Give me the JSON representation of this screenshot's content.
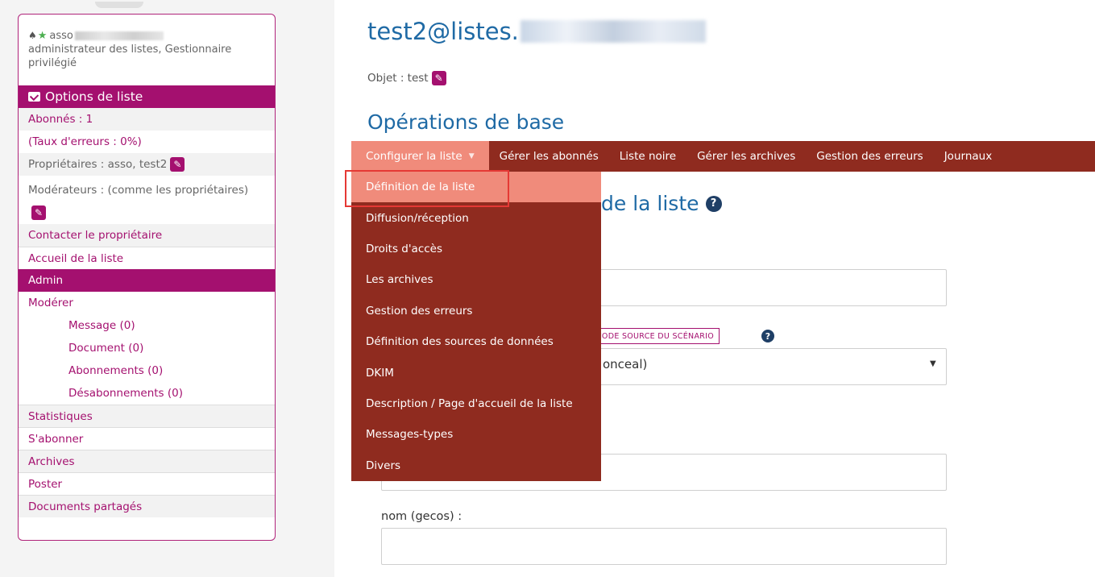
{
  "colors": {
    "accent": "#a4106f",
    "title_blue": "#1f6aa5",
    "menubar_bg": "#8f2b1f",
    "menu_highlight": "#f08b7b",
    "annotation_red": "#e53935"
  },
  "user": {
    "name_prefix": "asso",
    "roles": "administrateur des listes, Gestionnaire privilégié"
  },
  "sidebar": {
    "options_header": "Options de liste",
    "subscribers": "Abonnés : 1",
    "error_rate": "(Taux d'erreurs : 0%)",
    "owners": "Propriétaires : asso, test2",
    "moderators": "Modérateurs : (comme les propriétaires)",
    "contact_owner": "Contacter le propriétaire",
    "home": "Accueil de la liste",
    "admin": "Admin",
    "moderate": "Modérer",
    "moderate_items": [
      "Message (0)",
      "Document (0)",
      "Abonnements (0)",
      "Désabonnements (0)"
    ],
    "stats": "Statistiques",
    "subscribe": "S'abonner",
    "archives": "Archives",
    "post": "Poster",
    "shared_docs": "Documents partagés"
  },
  "main": {
    "list_title_prefix": "test2@listes.",
    "subject": "Objet : test",
    "ops_heading": "Opérations de base",
    "menubar": {
      "configure": "Configurer la liste",
      "items": [
        "Gérer les abonnés",
        "Liste noire",
        "Gérer les archives",
        "Gestion des erreurs",
        "Journaux"
      ]
    },
    "dropdown": [
      "Définition de la liste",
      "Diffusion/réception",
      "Droits d'accès",
      "Les archives",
      "Gestion des erreurs",
      "Définition des sources de données",
      "DKIM",
      "Description / Page d'accueil de la liste",
      "Messages-types",
      "Divers"
    ],
    "section_heading_tail": "de la liste",
    "scenario_button": "CODE SOURCE DU SCÉNARIO",
    "select_value_tail": "onceal)",
    "gecos_label": "nom (gecos) :"
  }
}
